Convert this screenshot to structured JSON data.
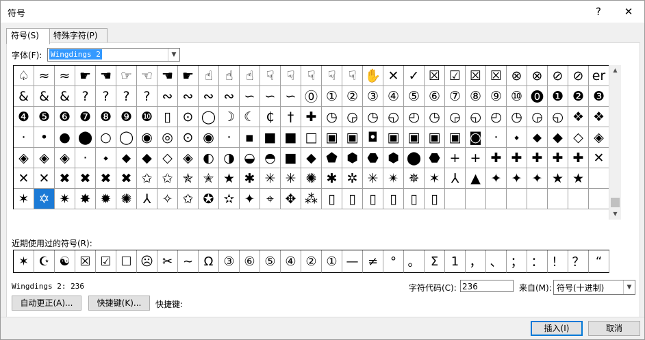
{
  "window": {
    "title": "符号",
    "help_icon": "?",
    "close_icon": "✕"
  },
  "tabs": [
    {
      "label": "符号(S)"
    },
    {
      "label": "特殊字符(P)"
    }
  ],
  "font": {
    "label": "字体(F):",
    "value": "Wingdings 2"
  },
  "symbols": [
    "♤",
    "≈",
    "≈",
    "☛",
    "☚",
    "☞",
    "☜",
    "☚",
    "☛",
    "☝",
    "☝",
    "☝",
    "☟",
    "☟",
    "☟",
    "☟",
    "☟",
    "✋",
    "✕",
    "✓",
    "☒",
    "☑",
    "☒",
    "☒",
    "⊗",
    "⊗",
    "⊘",
    "⊘",
    "er",
    "&",
    "&",
    "&",
    "?",
    "?",
    "?",
    "?",
    "∾",
    "∾",
    "∾",
    "∾",
    "∽",
    "∽",
    "∽",
    "⓪",
    "①",
    "②",
    "③",
    "④",
    "⑤",
    "⑥",
    "⑦",
    "⑧",
    "⑨",
    "⑩",
    "⓿",
    "❶",
    "❷",
    "❸",
    "❹",
    "❺",
    "❻",
    "❼",
    "❽",
    "❾",
    "❿",
    "▯",
    "⊙",
    "◯",
    "☽",
    "☾",
    "₵",
    "†",
    "✚",
    "◷",
    "◶",
    "◷",
    "◵",
    "◴",
    "◷",
    "◶",
    "◵",
    "◴",
    "◷",
    "◶",
    "◵",
    "❖",
    "❖",
    "·",
    "•",
    "●",
    "⬤",
    "○",
    "◯",
    "◉",
    "◎",
    "⊙",
    "◉",
    "·",
    "▪",
    "■",
    "■",
    "□",
    "▣",
    "▣",
    "◘",
    "▣",
    "▣",
    "▣",
    "▣",
    "◙",
    "·",
    "⬩",
    "⬥",
    "◆",
    "◇",
    "◈",
    "◈",
    "◈",
    "◈",
    "·",
    "⬩",
    "⬥",
    "◆",
    "◇",
    "◈",
    "◐",
    "◑",
    "◒",
    "◓",
    "■",
    "◆",
    "⬟",
    "⬢",
    "⬣",
    "⬢",
    "⬤",
    "⬣",
    "+",
    "+",
    "✚",
    "✚",
    "✚",
    "✚",
    "✚",
    "✕",
    "✕",
    "✕",
    "✖",
    "✖",
    "✖",
    "✖",
    "✩",
    "✩",
    "✯",
    "✭",
    "★",
    "✱",
    "✳",
    "✳",
    "✺",
    "✱",
    "✲",
    "✳",
    "✴",
    "✵",
    "✶",
    "⅄",
    "▲",
    "✦",
    "✦",
    "✦",
    "★",
    "★",
    "",
    "✶",
    "✡",
    "✷",
    "✸",
    "✹",
    "✺",
    "⅄",
    "✧",
    "✩",
    "✪",
    "✫",
    "✦",
    "⌖",
    "✥",
    "⁂",
    "▯",
    "▯",
    "▯",
    "▯",
    "▯",
    "▯",
    "",
    "",
    "",
    "",
    "",
    "",
    "",
    ""
  ],
  "recent": {
    "label": "近期使用过的符号(R):",
    "items": [
      "✶",
      "☪",
      "☯",
      "☒",
      "☑",
      "☐",
      "☹",
      "✂",
      "∼",
      "Ω",
      "③",
      "⑥",
      "⑤",
      "④",
      "②",
      "①",
      "—",
      "≠",
      "°",
      "。",
      "Σ",
      "1",
      "，",
      "、",
      "；",
      "：",
      "！",
      "？",
      "“"
    ]
  },
  "char_info": "Wingdings 2: 236",
  "char_code": {
    "label": "字符代码(C):",
    "value": "236"
  },
  "from": {
    "label": "来自(M):",
    "value": "符号(十进制)"
  },
  "buttons": {
    "autocorrect": "自动更正(A)...",
    "shortcut_key": "快捷键(K)...",
    "shortcut_label": "快捷键:",
    "insert": "插入(I)",
    "cancel": "取消"
  }
}
